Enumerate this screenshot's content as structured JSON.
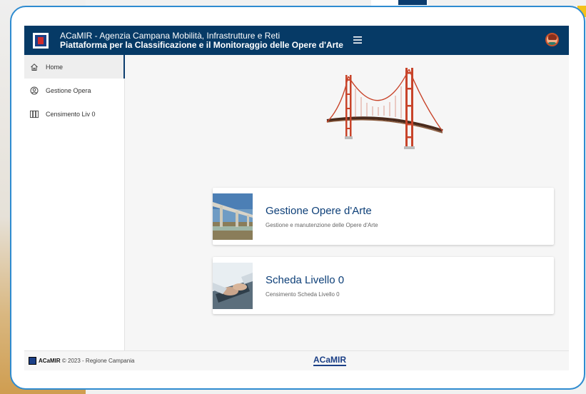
{
  "header": {
    "title_line1": "ACaMIR - Agenzia Campana Mobilità, Infrastrutture e Reti",
    "title_line2": "Piattaforma per la Classificazione e il Monitoraggio delle Opere d'Arte",
    "menu_icon": "hamburger-icon",
    "avatar_icon": "user-avatar"
  },
  "sidebar": {
    "items": [
      {
        "label": "Home",
        "icon": "home-icon",
        "active": true
      },
      {
        "label": "Gestione Opera",
        "icon": "user-circle-icon",
        "active": false
      },
      {
        "label": "Censimento Liv 0",
        "icon": "columns-icon",
        "active": false
      }
    ]
  },
  "cards": [
    {
      "title": "Gestione Opere d'Arte",
      "subtitle": "Gestione e manutenzione delle Opere d'Arte",
      "image": "bridge-photo"
    },
    {
      "title": "Scheda Livello 0",
      "subtitle": "Censimento Scheda Livello 0",
      "image": "laptop-typing-photo"
    }
  ],
  "footer": {
    "brand_bold": "ACaMIR",
    "text": "© 2023 - Regione Campania",
    "center_brand": "ACaMIR"
  },
  "colors": {
    "header_bg": "#063a66",
    "accent": "#0d3f78",
    "bridge_red": "#c8442a",
    "frame_border": "#2e8bd0"
  }
}
